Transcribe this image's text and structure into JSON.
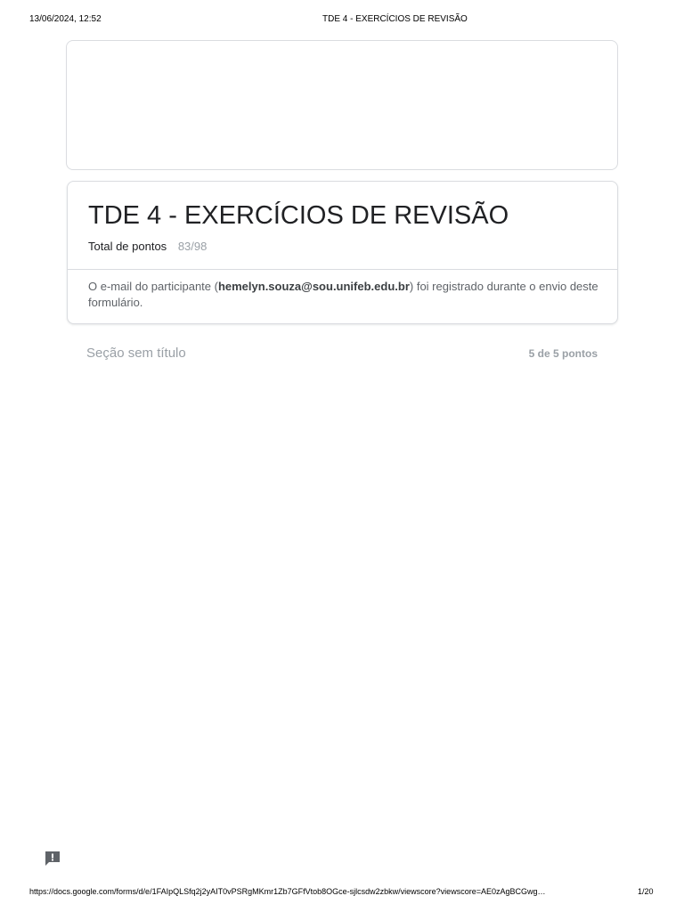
{
  "print_header": {
    "datetime": "13/06/2024, 12:52",
    "title": "TDE 4 - EXERCÍCIOS DE REVISÃO"
  },
  "form": {
    "title": "TDE 4 - EXERCÍCIOS DE REVISÃO",
    "score_label": "Total de pontos",
    "score_value": "83/98",
    "email_note_prefix": "O e-mail do participante (",
    "email": "hemelyn.souza@sou.unifeb.edu.br",
    "email_note_suffix": ") foi registrado durante o envio deste formulário."
  },
  "section": {
    "title": "Seção sem título",
    "points": "5 de 5 pontos"
  },
  "feedback": {
    "icon": "feedback-icon"
  },
  "print_footer": {
    "url": "https://docs.google.com/forms/d/e/1FAIpQLSfq2j2yAIT0vPSRgMKmr1Zb7GFfVtob8OGce-sjlcsdw2zbkw/viewscore?viewscore=AE0zAgBCGwg…",
    "page": "1/20"
  },
  "colors": {
    "text_primary": "#202124",
    "text_secondary": "#5f6368",
    "text_muted": "#9aa0a6",
    "border": "#dadce0",
    "feedback_icon": "#5f6368"
  }
}
